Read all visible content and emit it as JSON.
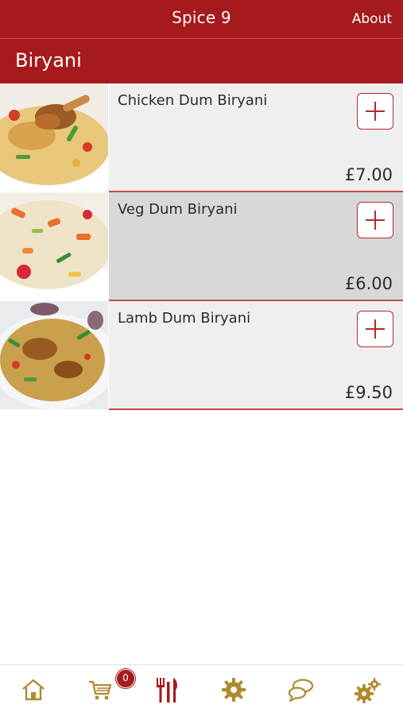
{
  "header": {
    "title": "Spice 9",
    "about_label": "About"
  },
  "section": {
    "title": "Biryani"
  },
  "items": [
    {
      "name": "Chicken Dum Biryani",
      "price": "£7.00",
      "image": "chicken-biryani-photo",
      "bg": "#efefef"
    },
    {
      "name": "Veg Dum Biryani",
      "price": "£6.00",
      "image": "veg-biryani-photo",
      "bg": "#d8d8d8"
    },
    {
      "name": "Lamb Dum Biryani",
      "price": "£9.50",
      "image": "lamb-biryani-photo",
      "bg": "#efefef"
    }
  ],
  "tabbar": {
    "cart_count": "0",
    "tabs": [
      "home-icon",
      "cart-icon",
      "menu-icon",
      "settings-icon",
      "chat-icon",
      "more-settings-icon"
    ]
  },
  "colors": {
    "brand_red": "#a6191c",
    "icon_gold": "#b08a2e",
    "accent_red": "#b7282b"
  }
}
